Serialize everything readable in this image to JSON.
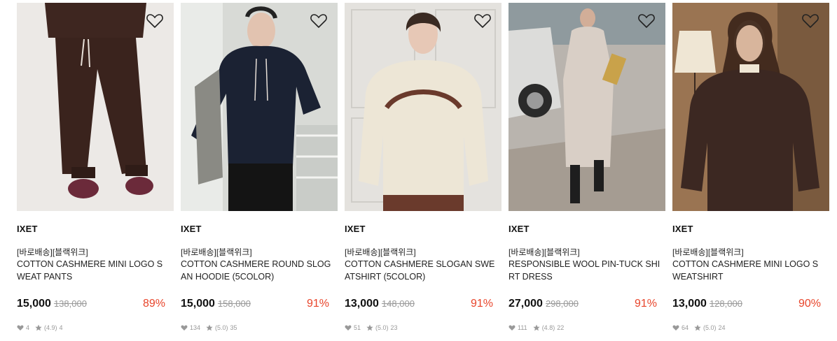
{
  "products": [
    {
      "brand": "IXET",
      "tag": "[바로배송][블랙위크]",
      "name": "COTTON CASHMERE MINI LOGO SWEAT PANTS",
      "sale_price": "15,000",
      "original_price": "138,000",
      "discount": "89%",
      "likes": "4",
      "rating": "(4.9)",
      "reviews": "4",
      "image_icon": "sweat-pants-photo",
      "image_colors": {
        "bg": "#ece9e6",
        "garment": "#3e2620",
        "accent": "#6b2a3a"
      }
    },
    {
      "brand": "IXET",
      "tag": "[바로배송][블랙위크]",
      "name": "COTTON CASHMERE ROUND SLOGAN HOODIE (5COLOR)",
      "sale_price": "15,000",
      "original_price": "158,000",
      "discount": "91%",
      "likes": "134",
      "rating": "(5.0)",
      "reviews": "35",
      "image_icon": "hoodie-photo",
      "image_colors": {
        "bg": "#d8dad6",
        "garment": "#1b2233",
        "accent": "#8a8a84"
      }
    },
    {
      "brand": "IXET",
      "tag": "[바로배송][블랙위크]",
      "name": "COTTON CASHMERE SLOGAN SWEATSHIRT (5COLOR)",
      "sale_price": "13,000",
      "original_price": "148,000",
      "discount": "91%",
      "likes": "51",
      "rating": "(5.0)",
      "reviews": "23",
      "image_icon": "sweatshirt-photo",
      "image_colors": {
        "bg": "#e4e2de",
        "garment": "#ede6d6",
        "accent": "#6a3a2c"
      }
    },
    {
      "brand": "IXET",
      "tag": "[바로배송][블랙위크]",
      "name": "RESPONSIBLE WOOL PIN-TUCK SHIRT DRESS",
      "sale_price": "27,000",
      "original_price": "298,000",
      "discount": "91%",
      "likes": "111",
      "rating": "(4.8)",
      "reviews": "22",
      "image_icon": "shirt-dress-photo",
      "image_colors": {
        "bg": "#b9b4ae",
        "garment": "#d9cfc6",
        "accent": "#1e1e1e"
      }
    },
    {
      "brand": "IXET",
      "tag": "[바로배송][블랙위크]",
      "name": "COTTON CASHMERE MINI LOGO SWEATSHIRT",
      "sale_price": "13,000",
      "original_price": "128,000",
      "discount": "90%",
      "likes": "64",
      "rating": "(5.0)",
      "reviews": "24",
      "image_icon": "sweatshirt-brown-photo",
      "image_colors": {
        "bg": "#9a7452",
        "garment": "#3c2822",
        "accent": "#efe6d4"
      }
    }
  ],
  "colors": {
    "discount": "#e8452b",
    "meta": "#999999"
  }
}
